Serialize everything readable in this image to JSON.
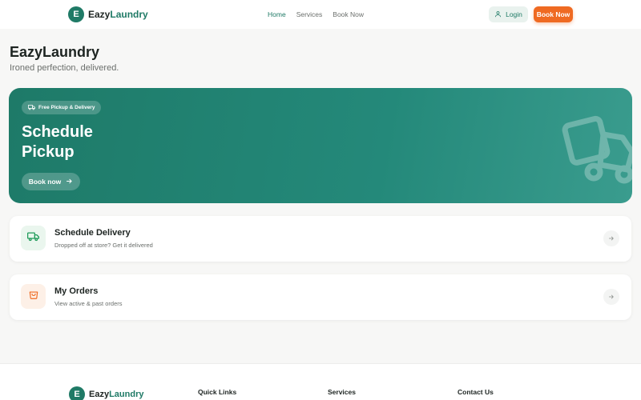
{
  "header": {
    "logo_letter": "E",
    "brand_prefix": "Eazy",
    "brand_suffix": "Laundry",
    "nav": [
      {
        "label": "Home",
        "active": true
      },
      {
        "label": "Services",
        "active": false
      },
      {
        "label": "Book Now",
        "active": false
      }
    ],
    "login_label": "Login",
    "book_label": "Book Now"
  },
  "page": {
    "title": "EazyLaundry",
    "subtitle": "Ironed perfection, delivered."
  },
  "hero": {
    "badge": "Free Pickup & Delivery",
    "title": "Schedule Pickup",
    "cta": "Book now"
  },
  "cards": [
    {
      "title": "Schedule Delivery",
      "subtitle": "Dropped off at store? Get it delivered",
      "icon": "truck-icon",
      "icon_color": "#1f9b5a",
      "icon_bg": "#eaf6ee"
    },
    {
      "title": "My Orders",
      "subtitle": "View active & past orders",
      "icon": "shopping-bag-icon",
      "icon_color": "#ef6a22",
      "icon_bg": "#fdf0e7"
    }
  ],
  "footer": {
    "logo_letter": "E",
    "brand_prefix": "Eazy",
    "brand_suffix": "Laundry",
    "columns": [
      "Quick Links",
      "Services",
      "Contact Us"
    ]
  },
  "colors": {
    "brand": "#1f7a66",
    "accent": "#ef6a22",
    "background": "#f7f7f6"
  }
}
